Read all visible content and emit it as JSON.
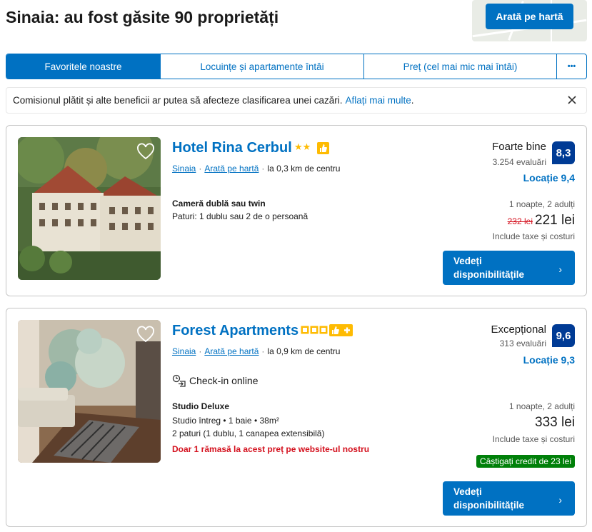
{
  "header": {
    "title": "Sinaia: au fost găsite 90 proprietăți",
    "map_button": "Arată pe hartă"
  },
  "sort_tabs": [
    {
      "label": "Favoritele noastre",
      "active": true
    },
    {
      "label": "Locuințe și apartamente întâi",
      "active": false
    },
    {
      "label": "Preț (cel mai mic mai întâi)",
      "active": false
    },
    {
      "label": "•••",
      "active": false
    }
  ],
  "notice": {
    "text": "Comisionul plătit și alte beneficii ar putea să afecteze clasificarea unei cazări.",
    "link": "Aflați mai multe",
    "link_suffix": "."
  },
  "properties": [
    {
      "name": "Hotel Rina Cerbul",
      "stars": "★★",
      "city_link": "Sinaia",
      "map_link": "Arată pe hartă",
      "distance": "la 0,3 km de centru",
      "room_title": "Cameră dublă sau twin",
      "room_line1": "Paturi: 1 dublu sau 2 de o persoană",
      "rating_word": "Foarte bine",
      "reviews": "3.254 evaluări",
      "score": "8,3",
      "location": "Locație 9,4",
      "nights": "1 noapte, 2 adulți",
      "old_price": "232 lei",
      "price": "221 lei",
      "taxes": "Include taxe și costuri",
      "cta_line1": "Vedeți",
      "cta_line2": "disponibilitățile"
    },
    {
      "name": "Forest Apartments",
      "stars": "",
      "city_link": "Sinaia",
      "map_link": "Arată pe hartă",
      "distance": "la 0,9 km de centru",
      "checkin": "Check-in online",
      "room_title": "Studio Deluxe",
      "room_line1": "Studio întreg • 1 baie • 38m²",
      "room_line2": "2 paturi (1 dublu, 1 canapea extensibilă)",
      "urgent": "Doar 1 rămasă la acest preț pe website-ul nostru",
      "rating_word": "Excepțional",
      "reviews": "313 evaluări",
      "score": "9,6",
      "location": "Locație 9,3",
      "nights": "1 noapte, 2 adulți",
      "price": "333 lei",
      "taxes": "Include taxe și costuri",
      "credit": "Câștigați credit de 23 lei",
      "cta_line1": "Vedeți",
      "cta_line2": "disponibilitățile"
    }
  ],
  "colors": {
    "brand_blue": "#0071c2",
    "score_blue": "#003b95",
    "star_yellow": "#febb02",
    "urgent_red": "#d4111e",
    "credit_green": "#008009"
  }
}
